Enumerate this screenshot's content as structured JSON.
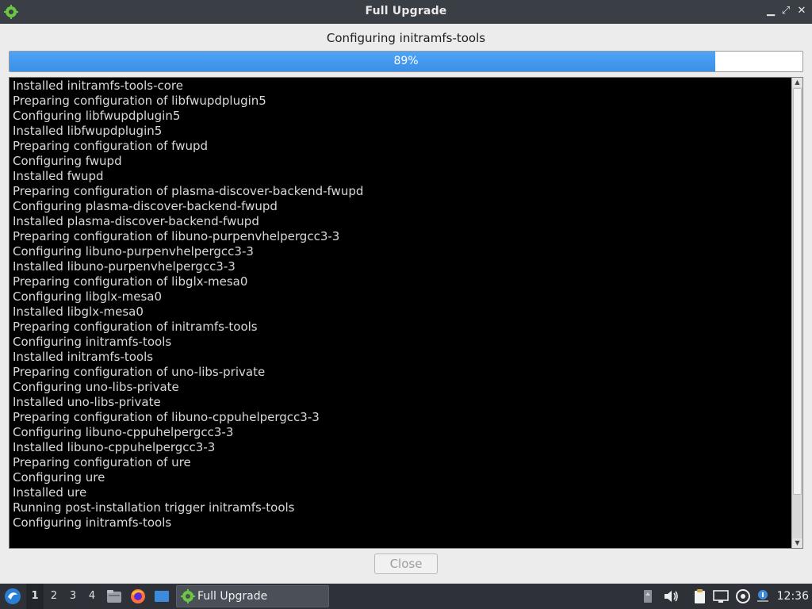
{
  "window": {
    "title": "Full Upgrade",
    "minimize_icon": "minimize-icon",
    "maximize_icon": "maximize-icon",
    "close_icon": "close-icon"
  },
  "status": {
    "label": "Configuring initramfs-tools",
    "progress_fraction": 0.89,
    "progress_text": "89%"
  },
  "log": {
    "lines": [
      "Installed initramfs-tools-core",
      "Preparing configuration of libfwupdplugin5",
      "Configuring libfwupdplugin5",
      "Installed libfwupdplugin5",
      "Preparing configuration of fwupd",
      "Configuring fwupd",
      "Installed fwupd",
      "Preparing configuration of plasma-discover-backend-fwupd",
      "Configuring plasma-discover-backend-fwupd",
      "Installed plasma-discover-backend-fwupd",
      "Preparing configuration of libuno-purpenvhelpergcc3-3",
      "Configuring libuno-purpenvhelpergcc3-3",
      "Installed libuno-purpenvhelpergcc3-3",
      "Preparing configuration of libglx-mesa0",
      "Configuring libglx-mesa0",
      "Installed libglx-mesa0",
      "Preparing configuration of initramfs-tools",
      "Configuring initramfs-tools",
      "Installed initramfs-tools",
      "Preparing configuration of uno-libs-private",
      "Configuring uno-libs-private",
      "Installed uno-libs-private",
      "Preparing configuration of libuno-cppuhelpergcc3-3",
      "Configuring libuno-cppuhelpergcc3-3",
      "Installed libuno-cppuhelpergcc3-3",
      "Preparing configuration of ure",
      "Configuring ure",
      "Installed ure",
      "Running post-installation trigger initramfs-tools",
      "Configuring initramfs-tools"
    ]
  },
  "buttons": {
    "close_label": "Close",
    "close_enabled": false
  },
  "taskbar": {
    "desktops": [
      "1",
      "2",
      "3",
      "4"
    ],
    "active_desktop": "1",
    "launchers": [
      "file-manager-icon",
      "firefox-icon",
      "desktop-icon"
    ],
    "task_label": "Full Upgrade",
    "tray_icons": [
      "storage-icon",
      "volume-icon",
      "clipboard-icon",
      "network-icon",
      "update-icon",
      "info-icon"
    ],
    "clock": "12:36"
  },
  "colors": {
    "progress_fill": "#3a8fe8",
    "log_background": "#000000",
    "log_text": "#d9d9d9",
    "titlebar": "#3a3f46",
    "taskbar": "#2e3238"
  }
}
